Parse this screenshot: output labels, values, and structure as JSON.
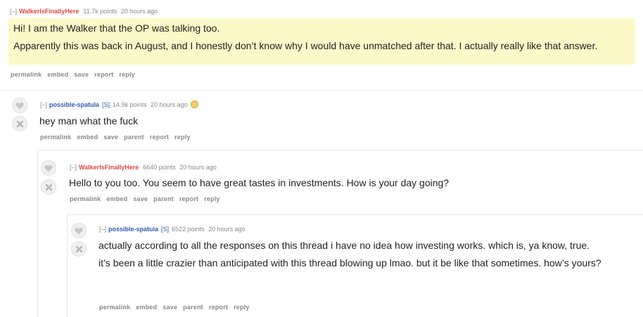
{
  "comments": [
    {
      "toggle": "[–]",
      "author": "WalkerIsFinallyHere",
      "flair": "",
      "score": "11.7k points",
      "time": "20 hours ago",
      "paragraphs": [
        "Hi! I am the Walker that the OP was talking too.",
        "Apparently this was back in August, and I honestly don’t know why I would have unmatched after that. I actually really like that answer."
      ],
      "buttons": [
        "permalink",
        "embed",
        "save",
        "report",
        "reply"
      ]
    },
    {
      "toggle": "[–]",
      "author": "possible-spatula",
      "flair": "[S]",
      "score": "14.9k points",
      "time": "20 hours ago",
      "paragraphs": [
        "hey man what the fuck"
      ],
      "buttons": [
        "permalink",
        "embed",
        "save",
        "parent",
        "report",
        "reply"
      ]
    },
    {
      "toggle": "[–]",
      "author": "WalkerIsFinallyHere",
      "flair": "",
      "score": "6640 points",
      "time": "20 hours ago",
      "paragraphs": [
        "Hello to you too. You seem to have great tastes in investments. How is your day going?"
      ],
      "buttons": [
        "permalink",
        "embed",
        "save",
        "parent",
        "report",
        "reply"
      ]
    },
    {
      "toggle": "[–]",
      "author": "possible-spatula",
      "flair": "[S]",
      "score": "6522 points",
      "time": "20 hours ago",
      "paragraphs": [
        "actually according to all the responses on this thread i have no idea how investing works. which is, ya know, true.",
        "it’s been a little crazier than anticipated with this thread blowing up lmao. but it be like that sometimes. how’s yours?"
      ],
      "buttons": [
        "permalink",
        "embed",
        "save",
        "parent",
        "report",
        "reply"
      ]
    }
  ],
  "colors": {
    "submitter": "#e0473f",
    "author": "#2a5db0",
    "highlight": "#fbf9c8",
    "meta": "#888888"
  }
}
